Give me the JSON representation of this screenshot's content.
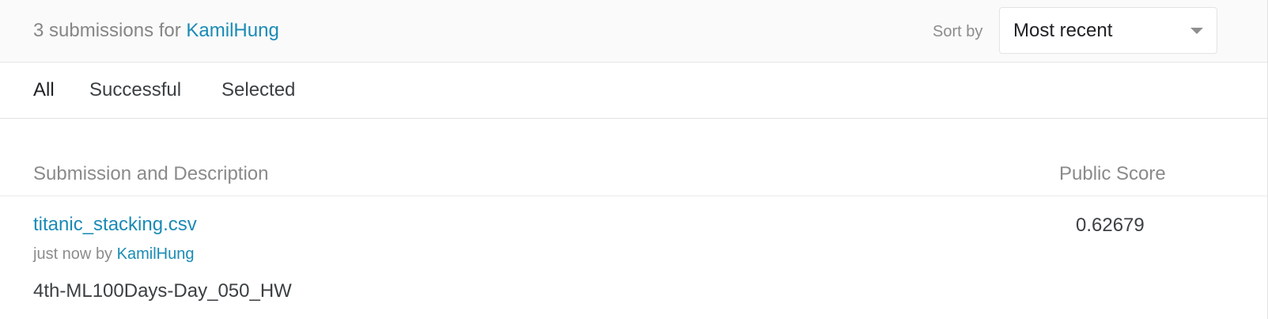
{
  "header": {
    "count_text": "3 submissions for",
    "user_name": "KamilHung",
    "sort_label": "Sort by",
    "sort_selected": "Most recent"
  },
  "icons": {
    "sort_dropdown": "chevron-down-icon"
  },
  "tabs": [
    {
      "label": "All",
      "active": true
    },
    {
      "label": "Successful",
      "active": false
    },
    {
      "label": "Selected",
      "active": false
    }
  ],
  "table": {
    "columns": [
      "Submission and Description",
      "Public Score"
    ],
    "rows": [
      {
        "file": "titanic_stacking.csv",
        "time": "just now",
        "by": "by",
        "user": "KamilHung",
        "description": "4th-ML100Days-Day_050_HW",
        "public_score": "0.62679"
      }
    ]
  },
  "colors": {
    "link": "#1a8bb5",
    "header_bg": "#fafafa",
    "muted_text": "#8a8a8a",
    "body_text": "#3c4043"
  }
}
